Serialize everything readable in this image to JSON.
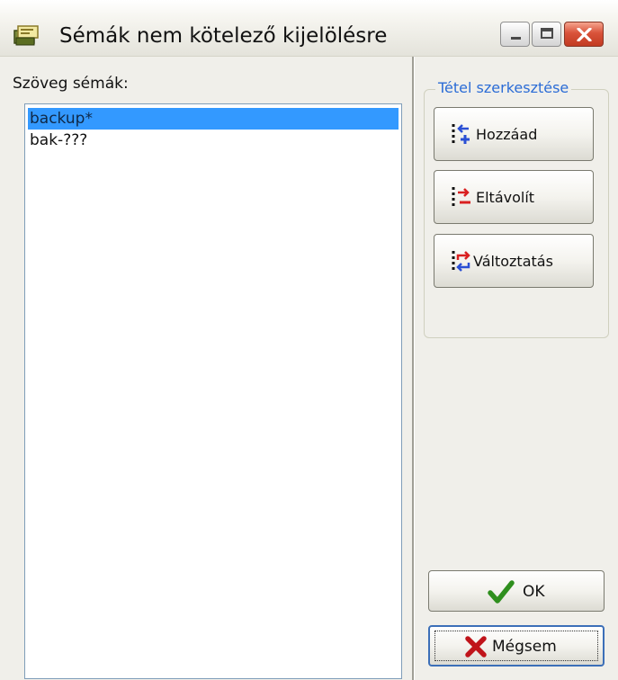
{
  "window": {
    "title": "Sémák nem kötelező kijelölésre",
    "icon": "app-icon",
    "caption_buttons": [
      "minimize-icon",
      "maximize-icon",
      "close-icon"
    ]
  },
  "list": {
    "label": "Szöveg sémák:",
    "items": [
      {
        "text": "backup*",
        "selected": true
      },
      {
        "text": "bak-???",
        "selected": false
      }
    ]
  },
  "edit_group": {
    "title": "Tétel szerkesztése",
    "buttons": [
      {
        "label": "Hozzáad",
        "icon": "add-item-icon"
      },
      {
        "label": "Eltávolít",
        "icon": "remove-item-icon"
      },
      {
        "label": "Változtatás",
        "icon": "change-item-icon"
      }
    ]
  },
  "dialog_buttons": {
    "ok": {
      "label": "OK",
      "icon": "checkmark-icon"
    },
    "cancel": {
      "label": "Mégsem",
      "icon": "x-mark-icon",
      "focused": true
    }
  },
  "colors": {
    "selection": "#3399ff",
    "group_title": "#2b6cd6",
    "close_button": "#c23b22"
  }
}
